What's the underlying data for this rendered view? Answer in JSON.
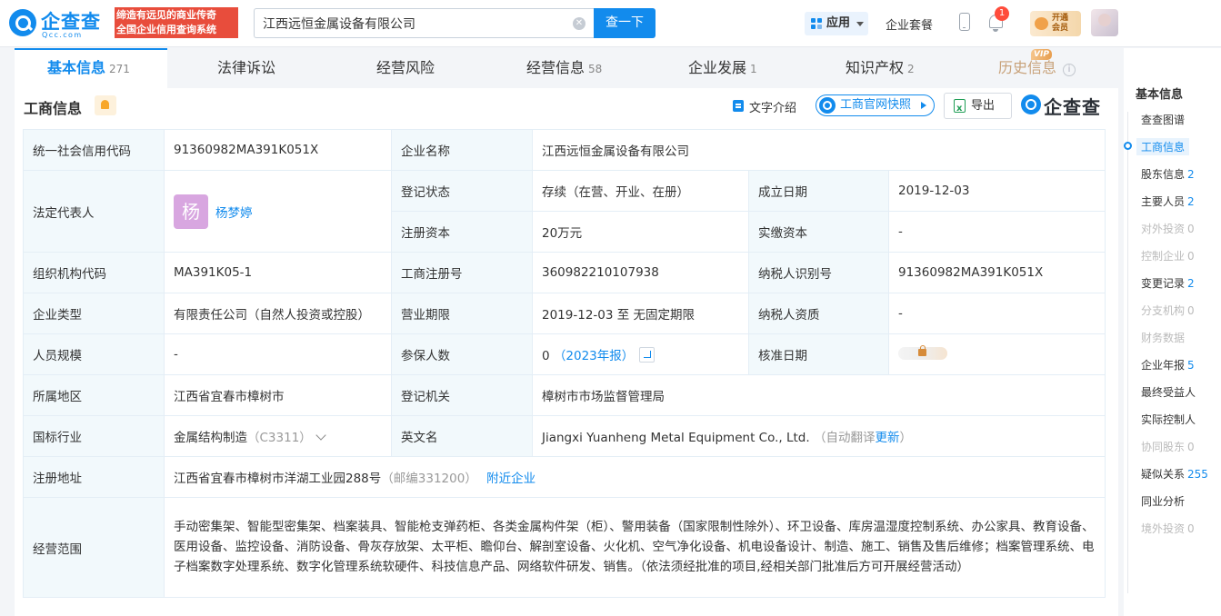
{
  "header": {
    "logo_cn": "企查查",
    "logo_en": "Qcc.com",
    "slogan_line1": "缔造有远见的商业传奇",
    "slogan_line2": "全国企业信用查询系统",
    "search_value": "江西远恒金属设备有限公司",
    "search_button": "查一下",
    "app_label": "应用",
    "suite_label": "企业套餐",
    "notif_count": "1",
    "vip_line1": "开通",
    "vip_line2": "会员"
  },
  "tabs": [
    {
      "label": "基本信息",
      "count": "271"
    },
    {
      "label": "法律诉讼",
      "count": ""
    },
    {
      "label": "经营风险",
      "count": ""
    },
    {
      "label": "经营信息",
      "count": "58"
    },
    {
      "label": "企业发展",
      "count": "1"
    },
    {
      "label": "知识产权",
      "count": "2"
    },
    {
      "label": "历史信息",
      "count": ""
    }
  ],
  "vip_tag": "VIP",
  "section": {
    "title": "工商信息",
    "doc_link": "文字介绍",
    "snapshot_button": "工商官网快照",
    "export_button": "导出",
    "brand": "企查查"
  },
  "info": {
    "credit_code_label": "统一社会信用代码",
    "credit_code": "91360982MA391K051X",
    "company_name_label": "企业名称",
    "company_name": "江西远恒金属设备有限公司",
    "legal_rep_label": "法定代表人",
    "legal_rep_avatar": "杨",
    "legal_rep": "杨梦婷",
    "reg_status_label": "登记状态",
    "reg_status": "存续（在营、开业、在册）",
    "founded_label": "成立日期",
    "founded": "2019-12-03",
    "reg_capital_label": "注册资本",
    "reg_capital": "20万元",
    "paid_capital_label": "实缴资本",
    "paid_capital": "-",
    "org_code_label": "组织机构代码",
    "org_code": "MA391K05-1",
    "biz_reg_no_label": "工商注册号",
    "biz_reg_no": "360982210107938",
    "taxpayer_id_label": "纳税人识别号",
    "taxpayer_id": "91360982MA391K051X",
    "company_type_label": "企业类型",
    "company_type": "有限责任公司（自然人投资或控股）",
    "biz_term_label": "营业期限",
    "biz_term": "2019-12-03 至 无固定期限",
    "taxpayer_qual_label": "纳税人资质",
    "taxpayer_qual": "-",
    "staff_size_label": "人员规模",
    "staff_size": "-",
    "insured_label": "参保人数",
    "insured": "0",
    "insured_report": "（2023年报）",
    "approval_label": "核准日期",
    "region_label": "所属地区",
    "region": "江西省宜春市樟树市",
    "authority_label": "登记机关",
    "authority": "樟树市市场监督管理局",
    "industry_label": "国标行业",
    "industry": "金属结构制造",
    "industry_code": "（C3311）",
    "english_name_label": "英文名",
    "english_name": "Jiangxi Yuanheng Metal Equipment Co., Ltd.",
    "english_note_pre": "（自动翻译",
    "english_note_link": "更新",
    "english_note_post": "）",
    "address_label": "注册地址",
    "address": "江西省宜春市樟树市洋湖工业园288号",
    "postcode": "（邮编331200）",
    "nearby_link": "附近企业",
    "scope_label": "经营范围",
    "scope": "手动密集架、智能型密集架、档案装具、智能枪支弹药柜、各类金属构件架（柜）、警用装备（国家限制性除外）、环卫设备、库房温湿度控制系统、办公家具、教育设备、医用设备、监控设备、消防设备、骨灰存放架、太平柜、瞻仰台、解剖室设备、火化机、空气净化设备、机电设备设计、制造、施工、销售及售后维修；档案管理系统、电子档案数字处理系统、数字化管理系统软硬件、科技信息产品、网络软件研发、销售。（依法须经批准的项目,经相关部门批准后方可开展经营活动）"
  },
  "rnav": {
    "title": "基本信息",
    "items": [
      {
        "label": "查查图谱",
        "count": "",
        "state": "normal"
      },
      {
        "label": "工商信息",
        "count": "",
        "state": "active"
      },
      {
        "label": "股东信息",
        "count": "2",
        "state": "normal"
      },
      {
        "label": "主要人员",
        "count": "2",
        "state": "normal"
      },
      {
        "label": "对外投资",
        "count": "0",
        "state": "disabled"
      },
      {
        "label": "控制企业",
        "count": "0",
        "state": "disabled"
      },
      {
        "label": "变更记录",
        "count": "2",
        "state": "normal"
      },
      {
        "label": "分支机构",
        "count": "0",
        "state": "disabled"
      },
      {
        "label": "财务数据",
        "count": "",
        "state": "disabled"
      },
      {
        "label": "企业年报",
        "count": "5",
        "state": "normal"
      },
      {
        "label": "最终受益人",
        "count": "",
        "state": "normal"
      },
      {
        "label": "实际控制人",
        "count": "",
        "state": "normal"
      },
      {
        "label": "协同股东",
        "count": "0",
        "state": "disabled"
      },
      {
        "label": "疑似关系",
        "count": "255",
        "state": "normal"
      },
      {
        "label": "同业分析",
        "count": "",
        "state": "normal"
      },
      {
        "label": "境外投资",
        "count": "0",
        "state": "disabled"
      }
    ]
  },
  "colors": {
    "brand_blue": "#128bed",
    "slogan_red": "#e84d3c",
    "label_bg": "#f2f9fc"
  }
}
